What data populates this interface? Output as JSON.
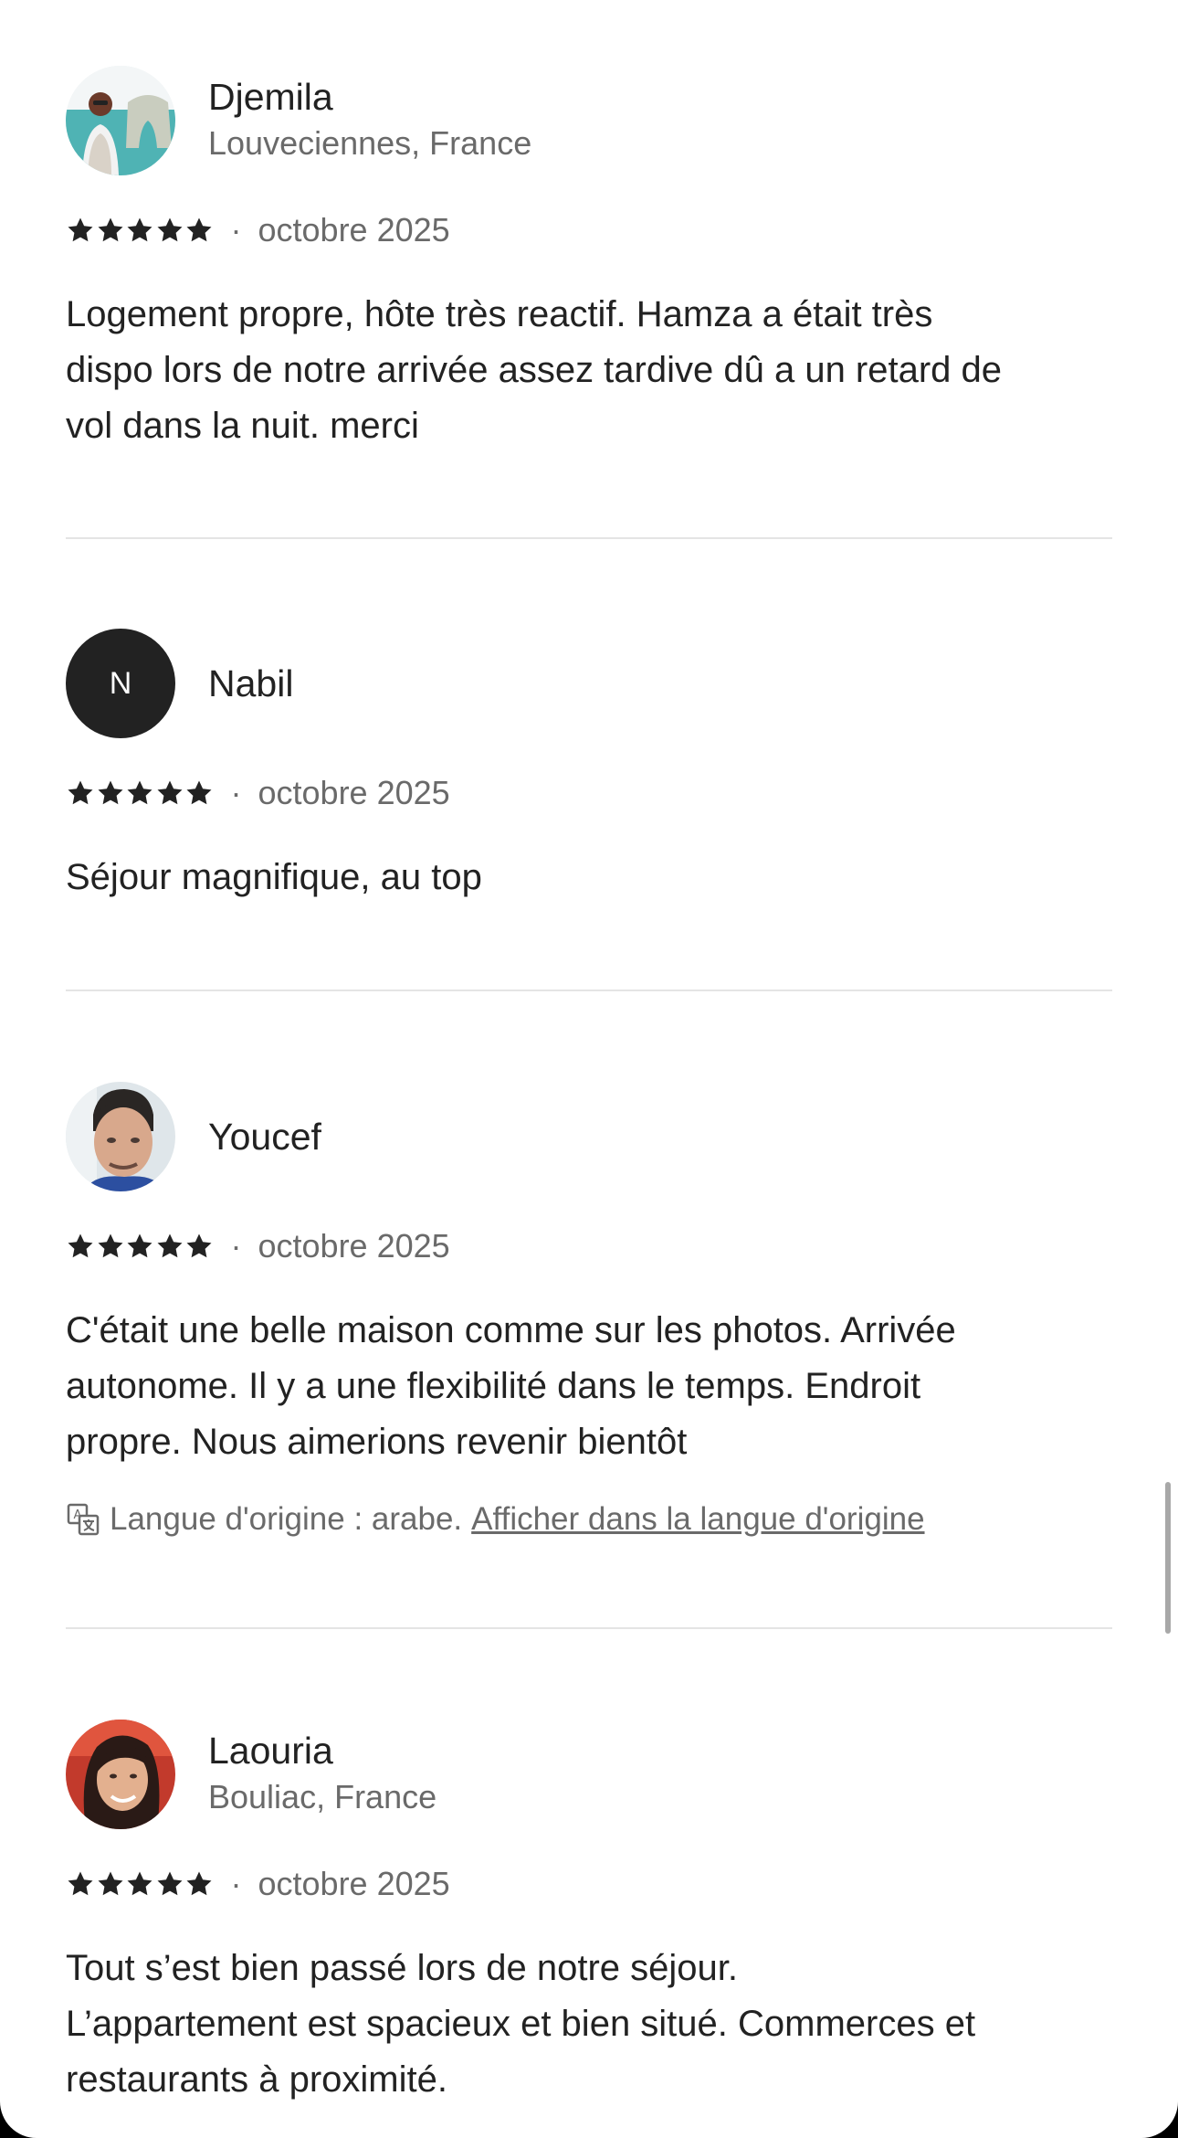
{
  "reviews": [
    {
      "name": "Djemila",
      "location": "Louveciennes, France",
      "avatar": "photo",
      "rating": 5,
      "separator": "·",
      "date": "octobre 2025",
      "text": "Logement propre, hôte très reactif. Hamza a était très\ndispo lors de notre arrivée assez tardive dû a un retard de\nvol dans la nuit. merci"
    },
    {
      "name": "Nabil",
      "initial": "N",
      "avatar": "initial",
      "rating": 5,
      "separator": "·",
      "date": "octobre 2025",
      "text": "Séjour magnifique, au top"
    },
    {
      "name": "Youcef",
      "avatar": "photo",
      "rating": 5,
      "separator": "·",
      "date": "octobre 2025",
      "text": "C'était une belle maison comme sur les photos. Arrivée\nautonome. Il y a une flexibilité dans le temps. Endroit\npropre. Nous aimerions revenir bientôt",
      "translation_note": "Langue d'origine : arabe.",
      "translation_link": "Afficher dans la langue d'origine"
    },
    {
      "name": "Laouria",
      "location": "Bouliac, France",
      "avatar": "photo",
      "rating": 5,
      "separator": "·",
      "date": "octobre 2025",
      "text": "Tout s’est bien passé lors de notre séjour.\nL’appartement est spacieux et bien situé. Commerces et\nrestaurants à proximité."
    }
  ],
  "colors": {
    "text_primary": "#222222",
    "text_secondary": "#6a6a6a",
    "divider": "#e4e4e4",
    "star": "#222222",
    "avatar_initial_bg": "#222222"
  },
  "icons": {
    "star": "star-icon",
    "translate": "translate-icon"
  }
}
